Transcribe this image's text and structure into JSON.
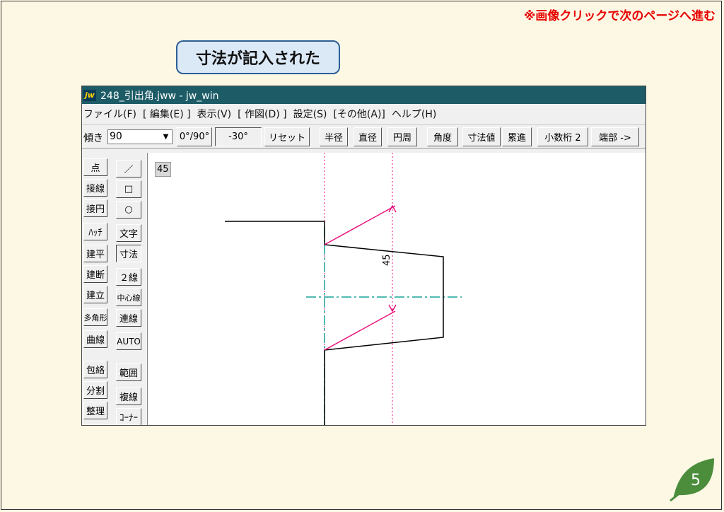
{
  "slide": {
    "notice": "※画像クリックで次のページへ進む",
    "caption": "寸法が記入された",
    "page_number": "5",
    "accent_color": "#4c8d3c",
    "notice_color": "#e60000"
  },
  "window": {
    "icon_text": "jw",
    "title": "248_引出角.jww - jw_win",
    "menu": [
      "ファイル(F)",
      "[ 編集(E) ]",
      "表示(V)",
      "[ 作図(D) ]",
      "設定(S)",
      "[その他(A)]",
      "ヘルプ(H)"
    ],
    "toolbar": {
      "angle_label": "傾き",
      "angle_value": "90",
      "dropdown_icon": "▼",
      "buttons": [
        "0°/90°",
        "-30°",
        "リセット",
        "半径",
        "直径",
        "円周",
        "角度",
        "寸法値",
        "累進",
        "小数桁 2",
        "端部 ->"
      ]
    },
    "palette_left": [
      "点",
      "接線",
      "接円",
      "ﾊｯﾁ",
      "建平",
      "建断",
      "建立",
      "多角形",
      "曲線",
      "包絡",
      "分割",
      "整理"
    ],
    "palette_right": [
      "／",
      "□",
      "○",
      "文字",
      "寸法",
      "２線",
      "中心線",
      "連線",
      "AUTO",
      "範囲",
      "複線",
      "ｺｰﾅｰ"
    ],
    "canvas": {
      "readout": "45",
      "dimension_text": "45",
      "colors": {
        "drawing": "#000000",
        "dimension": "#e8127c",
        "guide": "#e8127c",
        "centerline": "#1aa39a"
      }
    }
  }
}
